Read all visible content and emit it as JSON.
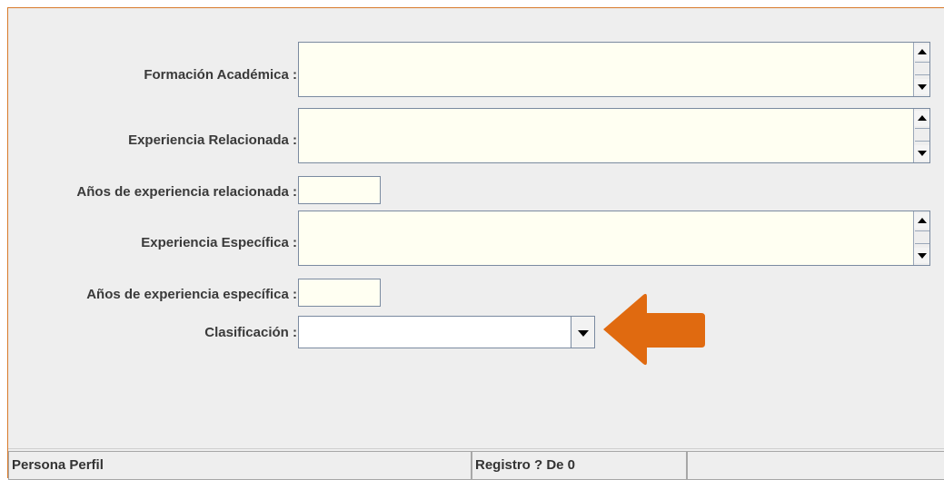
{
  "form": {
    "formacion_label": "Formación Académica :",
    "exp_relacionada_label": "Experiencia Relacionada :",
    "anios_relacionada_label": "Años de experiencia relacionada :",
    "exp_especifica_label": "Experiencia Específica :",
    "anios_especifica_label": "Años de experiencia específica :",
    "clasificacion_label": "Clasificación :",
    "formacion_value": "",
    "exp_relacionada_value": "",
    "anios_relacionada_value": "",
    "exp_especifica_value": "",
    "anios_especifica_value": "",
    "clasificacion_value": ""
  },
  "statusbar": {
    "entity": "Persona Perfil",
    "record": "Registro ? De 0",
    "extra": ""
  },
  "colors": {
    "frame_border": "#d87a2a",
    "field_bg": "#fffff2",
    "annotation_arrow": "#e06a10"
  },
  "icons": {
    "scroll_up": "triangle-up-icon",
    "scroll_down": "triangle-down-icon",
    "dropdown": "chevron-down-icon",
    "annotation": "arrow-left-icon"
  }
}
